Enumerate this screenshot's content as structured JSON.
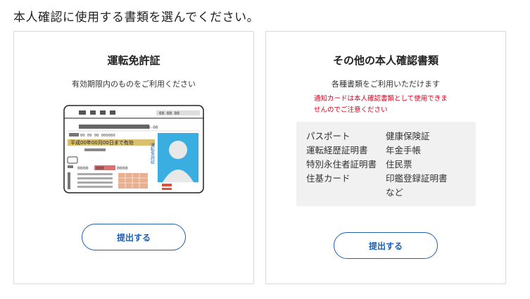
{
  "page": {
    "heading": "本人確認に使用する書類を選んでください。"
  },
  "license_card": {
    "title": "運転免許証",
    "subtitle": "有効期限内のものをご利用ください",
    "submit_label": "提出する",
    "illustration": {
      "expiry_text": "平成00年00月00日まで有効",
      "side_label": "運転免許証",
      "photo_color": "#3aaee0",
      "expiry_band_color": "#d9c070"
    }
  },
  "other_docs_card": {
    "title": "その他の本人確認書類",
    "subtitle": "各種書類をご利用いただけます",
    "warning_line1": "通知カードは本人確認書類として使用できま",
    "warning_line2": "せんのでご注意ください",
    "documents": [
      "パスポート",
      "健康保険証",
      "運転経歴証明書",
      "年金手帳",
      "特別永住者証明書",
      "住民票",
      "住基カード",
      "印鑑登録証明書",
      "",
      "など"
    ],
    "submit_label": "提出する"
  },
  "colors": {
    "accent": "#1f5fb3",
    "warning": "#d0021b",
    "doc_box_bg": "#f1f1f1"
  }
}
